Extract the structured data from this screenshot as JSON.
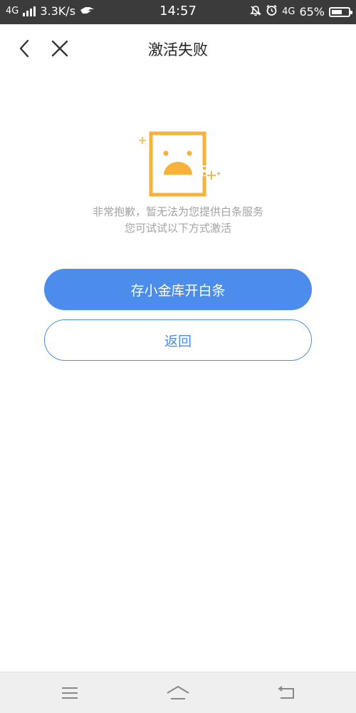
{
  "status_bar": {
    "network_left": "4G",
    "speed": "3.3K/s",
    "time": "14:57",
    "network_right": "4G",
    "battery": "65%",
    "battery_level": 0.65,
    "icons": [
      "signal-icon",
      "hand-icon",
      "mute-bell-icon",
      "alarm-icon",
      "battery-icon"
    ]
  },
  "header": {
    "title": "激活失败",
    "back_icon": "chevron-left-icon",
    "close_icon": "close-icon"
  },
  "illustration": {
    "icon": "sad-face-icon",
    "accent_color": "#f8b23c"
  },
  "message": {
    "line1": "非常抱歉，暂无法为您提供白条服务",
    "line2": "您可试试以下方式激活"
  },
  "buttons": {
    "primary": "存小金库开白条",
    "secondary": "返回"
  },
  "colors": {
    "accent": "#4c8ceb",
    "status_bar_bg": "#3b3b3b",
    "nav_bar_bg": "#efefef"
  },
  "nav_bar": {
    "icons": [
      "menu-icon",
      "home-icon",
      "back-icon"
    ]
  }
}
